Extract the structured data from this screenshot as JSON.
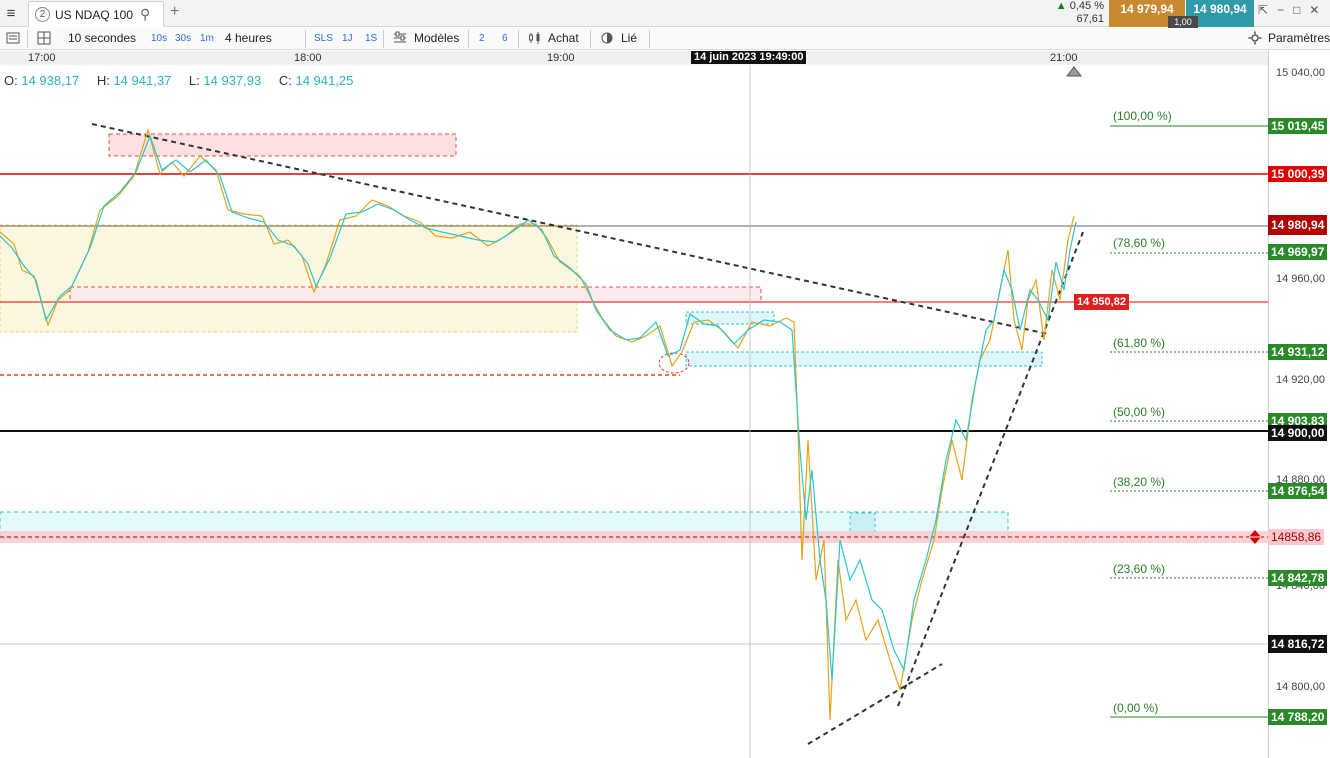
{
  "tab": {
    "number": "2",
    "title": "US NDAQ 100"
  },
  "quote": {
    "change_pct": "0,45 %",
    "change_abs": "67,61",
    "bid": "14 979,94",
    "ask": "14 980,94",
    "spread": "1,00"
  },
  "toolbar": {
    "interval": "10 secondes",
    "intervals": [
      "10s",
      "30s",
      "1m"
    ],
    "range": "4 heures",
    "ranges": [
      "SLS",
      "1J",
      "1S"
    ],
    "models": "Modèles",
    "periods": [
      "2",
      "6"
    ],
    "buy": "Achat",
    "linked": "Lié",
    "settings": "Paramètres"
  },
  "time_axis": {
    "labels": [
      "17:00",
      "18:00",
      "19:00",
      "21:00"
    ],
    "cursor": "14 juin 2023 19:49:00"
  },
  "ohlc": {
    "o_label": "O:",
    "o": "14 938,17",
    "h_label": "H:",
    "h": "14 941,37",
    "l_label": "L:",
    "l": "14 937,93",
    "c_label": "C:",
    "c": "14 941,25"
  },
  "price_axis": {
    "labels": [
      "15 040,00",
      "14 960,00",
      "14 920,00",
      "14 880,00",
      "14 840,00",
      "14 800,00"
    ]
  },
  "price_tags": {
    "fib_100": "15 019,45",
    "res_15000": "15 000,39",
    "last": "14 980,94",
    "fib_786": "14 969,97",
    "level_14950": "14 950,82",
    "fib_618": "14 931,12",
    "fib_50": "14 903,83",
    "level_14900": "14 900,00",
    "fib_382": "14 876,54",
    "alert": "14858,86",
    "fib_236": "14 842,78",
    "cursor_price": "14 816,72",
    "fib_0": "14 788,20"
  },
  "fib_labels": {
    "f100": "(100,00 %)",
    "f786": "(78,60 %)",
    "f618": "(61,80 %)",
    "f50": "(50,00 %)",
    "f382": "(38,20 %)",
    "f236": "(23,60 %)",
    "f0": "(0,00 %)"
  },
  "colors": {
    "bid": "#c9892f",
    "ask": "#2f9aa8",
    "fib": "#2a7d2a",
    "resistance": "#e00000",
    "line_a": "#2bc4d0",
    "line_b": "#e6a21a"
  }
}
